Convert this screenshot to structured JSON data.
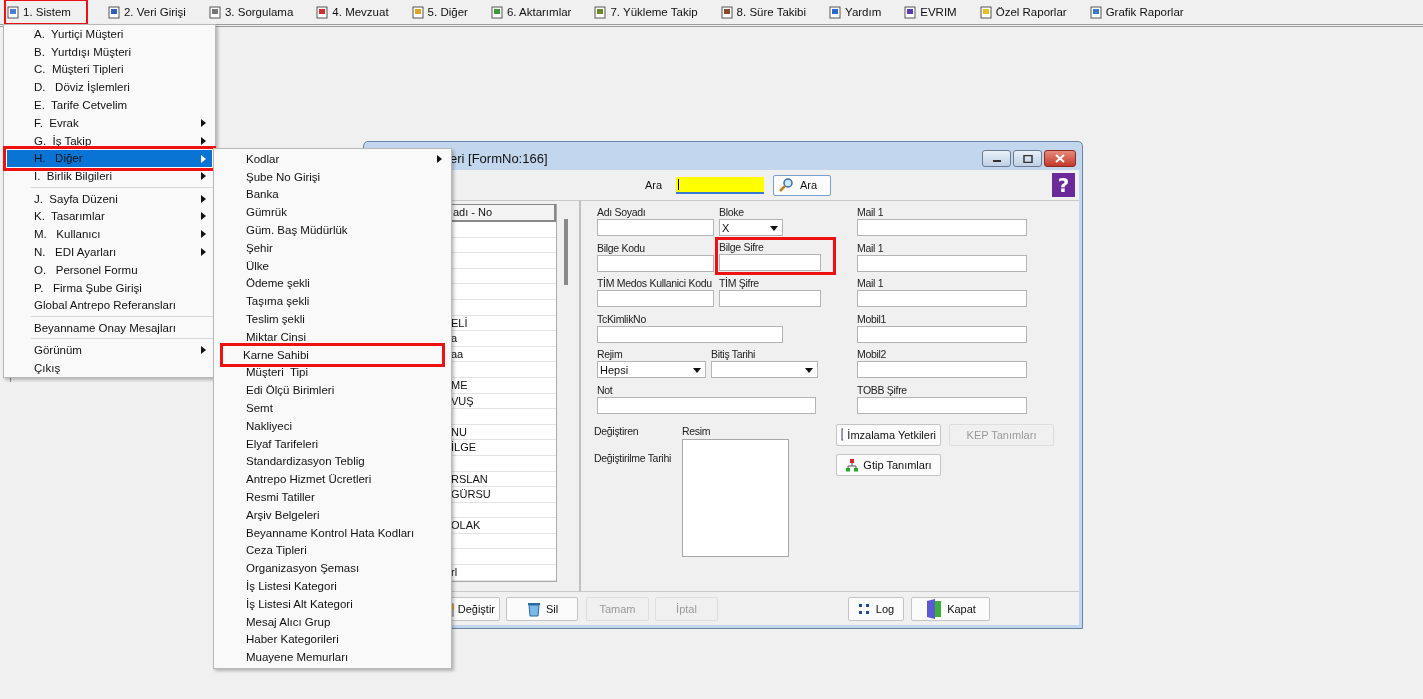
{
  "menu_bar": [
    {
      "label": "1. Sistem",
      "highlighted": true
    },
    {
      "label": "2. Veri Girişi",
      "highlighted": false
    },
    {
      "label": "3. Sorgulama",
      "highlighted": false
    },
    {
      "label": "4. Mevzuat",
      "highlighted": false
    },
    {
      "label": "5. Diğer",
      "highlighted": false
    },
    {
      "label": "6. Aktarımlar",
      "highlighted": false
    },
    {
      "label": "7. Yükleme Takip",
      "highlighted": false
    },
    {
      "label": "8. Süre Takibi",
      "highlighted": false
    },
    {
      "label": "Yardım",
      "highlighted": false
    },
    {
      "label": "EVRIM",
      "highlighted": false
    },
    {
      "label": "Özel Raporlar",
      "highlighted": false
    },
    {
      "label": "Grafik Raporlar",
      "highlighted": false
    }
  ],
  "system_menu": [
    {
      "kind": "item",
      "label": "A.  Yurtiçi Müşteri",
      "selected": false,
      "highlighted": false
    },
    {
      "kind": "item",
      "label": "B.  Yurtdışı Müşteri",
      "selected": false,
      "highlighted": false
    },
    {
      "kind": "item",
      "label": "C.  Müşteri Tipleri",
      "selected": false,
      "highlighted": false
    },
    {
      "kind": "item",
      "label": "D.   Döviz İşlemleri",
      "selected": false,
      "highlighted": false
    },
    {
      "kind": "item",
      "label": "E.  Tarife Cetvelim",
      "selected": false,
      "highlighted": false
    },
    {
      "kind": "branch",
      "label": "F.  Evrak",
      "selected": false,
      "highlighted": false
    },
    {
      "kind": "branch",
      "label": "G.  İş Takip",
      "selected": false,
      "highlighted": false
    },
    {
      "kind": "branch",
      "label": "H.   Diğer",
      "selected": true,
      "highlighted": true
    },
    {
      "kind": "branch",
      "label": "I.  Birlik Bilgileri",
      "selected": false,
      "highlighted": false
    },
    {
      "kind": "separator"
    },
    {
      "kind": "branch",
      "label": "J.  Sayfa Düzeni",
      "selected": false,
      "highlighted": false
    },
    {
      "kind": "branch",
      "label": "K.  Tasarımlar",
      "selected": false,
      "highlighted": false
    },
    {
      "kind": "branch",
      "label": "M.   Kullanıcı",
      "selected": false,
      "highlighted": false
    },
    {
      "kind": "branch",
      "label": "N.   EDI Ayarları",
      "selected": false,
      "highlighted": false
    },
    {
      "kind": "item",
      "label": "O.   Personel Formu",
      "selected": false,
      "highlighted": false
    },
    {
      "kind": "item",
      "label": "P.   Firma Şube Girişi",
      "selected": false,
      "highlighted": false
    },
    {
      "kind": "item",
      "label": "Global Antrepo Referansları",
      "selected": false,
      "highlighted": false
    },
    {
      "kind": "separator"
    },
    {
      "kind": "item",
      "label": "Beyanname Onay Mesajları",
      "selected": false,
      "highlighted": false
    },
    {
      "kind": "separator"
    },
    {
      "kind": "branch",
      "label": "Görünüm",
      "selected": false,
      "highlighted": false
    },
    {
      "kind": "item",
      "label": "Çıkış",
      "selected": false,
      "highlighted": false
    }
  ],
  "other_submenu": [
    {
      "kind": "branch",
      "label": "Kodlar",
      "selected": false,
      "highlighted": false
    },
    {
      "kind": "item",
      "label": "Şube No Girişi",
      "selected": false,
      "highlighted": false
    },
    {
      "kind": "item",
      "label": "Banka",
      "selected": false,
      "highlighted": false
    },
    {
      "kind": "item",
      "label": "Gümrük",
      "selected": false,
      "highlighted": false
    },
    {
      "kind": "item",
      "label": "Güm. Baş Müdürlük",
      "selected": false,
      "highlighted": false
    },
    {
      "kind": "item",
      "label": "Şehir",
      "selected": false,
      "highlighted": false
    },
    {
      "kind": "item",
      "label": "Ülke",
      "selected": false,
      "highlighted": false
    },
    {
      "kind": "item",
      "label": "Ödeme şekli",
      "selected": false,
      "highlighted": false
    },
    {
      "kind": "item",
      "label": "Taşıma şekli",
      "selected": false,
      "highlighted": false
    },
    {
      "kind": "item",
      "label": "Teslim şekli",
      "selected": false,
      "highlighted": false
    },
    {
      "kind": "item",
      "label": "Miktar Cinsi",
      "selected": false,
      "highlighted": false
    },
    {
      "kind": "item",
      "label": "Karne Sahibi",
      "selected": false,
      "highlighted": true
    },
    {
      "kind": "item",
      "label": "Müşteri  Tipi",
      "selected": false,
      "highlighted": false
    },
    {
      "kind": "item",
      "label": "Edi Ölçü Birimleri",
      "selected": false,
      "highlighted": false
    },
    {
      "kind": "item",
      "label": "Semt",
      "selected": false,
      "highlighted": false
    },
    {
      "kind": "item",
      "label": "Nakliyeci",
      "selected": false,
      "highlighted": false
    },
    {
      "kind": "item",
      "label": "Elyaf Tarifeleri",
      "selected": false,
      "highlighted": false
    },
    {
      "kind": "item",
      "label": "Standardizasyon Teblig",
      "selected": false,
      "highlighted": false
    },
    {
      "kind": "item",
      "label": "Antrepo Hizmet Ücretleri",
      "selected": false,
      "highlighted": false
    },
    {
      "kind": "item",
      "label": "Resmi Tatiller",
      "selected": false,
      "highlighted": false
    },
    {
      "kind": "item",
      "label": "Arşiv Belgeleri",
      "selected": false,
      "highlighted": false
    },
    {
      "kind": "item",
      "label": "Beyanname Kontrol Hata Kodları",
      "selected": false,
      "highlighted": false
    },
    {
      "kind": "item",
      "label": "Ceza Tipleri",
      "selected": false,
      "highlighted": false
    },
    {
      "kind": "item",
      "label": "Organizasyon Şeması",
      "selected": false,
      "highlighted": false
    },
    {
      "kind": "item",
      "label": "İş Listesi Kategori",
      "selected": false,
      "highlighted": false
    },
    {
      "kind": "item",
      "label": "İş Listesi Alt Kategori",
      "selected": false,
      "highlighted": false
    },
    {
      "kind": "item",
      "label": "Mesaj Alıcı Grup",
      "selected": false,
      "highlighted": false
    },
    {
      "kind": "item",
      "label": "Haber Kategorileri",
      "selected": false,
      "highlighted": false
    },
    {
      "kind": "item",
      "label": "Muayene Memurları",
      "selected": false,
      "highlighted": false
    }
  ],
  "form_window": {
    "title": "eri [FormNo:166]",
    "help_glyph": "?",
    "search": {
      "label": "Ara",
      "button": "Ara"
    },
    "list": {
      "header": "adı - No",
      "rows": [
        {},
        {},
        {},
        {},
        {},
        {},
        {
          "text": "ELİ"
        },
        {
          "text": "a"
        },
        {
          "text": "aa"
        },
        {},
        {
          "text": "ME"
        },
        {
          "text": "VUŞ"
        },
        {},
        {
          "text": "NU"
        },
        {
          "text": "İLGE"
        },
        {},
        {
          "text": "RSLAN"
        },
        {
          "text": "GÜRSU"
        },
        {},
        {
          "text": "OLAK"
        },
        {},
        {},
        {
          "text": "rl"
        }
      ]
    },
    "left_rows": [
      [
        {
          "label": "Adı Soyadı",
          "kind": "text",
          "highlighted": false
        },
        {
          "label": "Bloke",
          "kind": "combo",
          "value": "X",
          "highlighted": false
        }
      ],
      [
        {
          "label": "Bilge Kodu",
          "kind": "text",
          "highlighted": false
        },
        {
          "label": "Bilge Sifre",
          "kind": "text",
          "highlighted": true
        }
      ],
      [
        {
          "label": "TİM Medos Kullanici Kodu",
          "kind": "text",
          "highlighted": false
        },
        {
          "label": "TİM Şifre",
          "kind": "text",
          "highlighted": false
        }
      ],
      [
        {
          "label": "TcKimlikNo",
          "kind": "text",
          "highlighted": false
        }
      ],
      [
        {
          "label": "Rejim",
          "kind": "combo",
          "value": "Hepsi",
          "highlighted": false
        },
        {
          "label": "Bitiş Tarihi",
          "kind": "combo",
          "highlighted": false
        }
      ],
      [
        {
          "label": "Not",
          "kind": "text",
          "highlighted": false
        }
      ]
    ],
    "right_fields": [
      {
        "label": "Mail 1"
      },
      {
        "label": "Mail 1"
      },
      {
        "label": "Mail 1"
      },
      {
        "label": "Mobil1"
      },
      {
        "label": "Mobil2"
      },
      {
        "label": "TOBB Şifre"
      }
    ],
    "changed_by_label": "Değiştiren",
    "changed_date_label": "Değiştirilme Tarihi",
    "image_label": "Resim",
    "side_buttons": [
      {
        "label": "İmzalama Yetkileri",
        "disabled": false
      },
      {
        "label": "KEP Tanımları",
        "disabled": true
      },
      {
        "label": "Gtip Tanımları",
        "disabled": false
      }
    ],
    "bottom_buttons": [
      {
        "label": "Değiştir",
        "disabled": false
      },
      {
        "label": "Sil",
        "disabled": false
      },
      {
        "label": "Tamam",
        "disabled": true
      },
      {
        "label": "İptal",
        "disabled": true
      },
      {
        "label": "Log",
        "disabled": false
      },
      {
        "label": "Kapat",
        "disabled": false
      }
    ]
  }
}
